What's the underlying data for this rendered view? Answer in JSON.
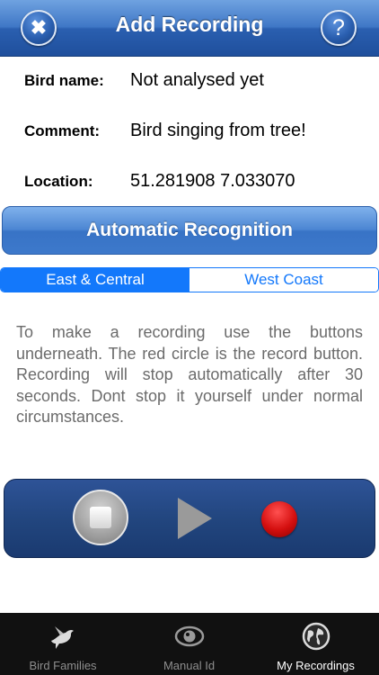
{
  "nav": {
    "title": "Add Recording",
    "close_glyph": "✖",
    "help_glyph": "?"
  },
  "info": {
    "bird_name_label": "Bird name:",
    "bird_name_value": "Not analysed yet",
    "comment_label": "Comment:",
    "comment_value": "Bird singing from tree!",
    "location_label": "Location:",
    "location_value": "51.281908 7.033070"
  },
  "auto_recognition_label": "Automatic Recognition",
  "region_tabs": [
    "East & Central",
    "West Coast"
  ],
  "region_selected": "East & Central",
  "instructions": "To make a recording use the buttons underneath. The red circle is the record button. Recording will stop automatically after 30 seconds. Dont stop it yourself under normal circumstances.",
  "player": {
    "stop_icon": "stop-icon",
    "play_icon": "play-icon",
    "record_icon": "record-icon"
  },
  "tabbar": [
    {
      "label": "Bird Families",
      "icon": "bird-icon",
      "selected": false
    },
    {
      "label": "Manual Id",
      "icon": "eye-icon",
      "selected": false
    },
    {
      "label": "My Recordings",
      "icon": "globe-icon",
      "selected": true
    }
  ],
  "colors": {
    "nav_blue": "#2a5fb0",
    "segment_blue": "#1378fb",
    "record_red": "#d40f0f",
    "tabbar_bg": "#111111"
  }
}
